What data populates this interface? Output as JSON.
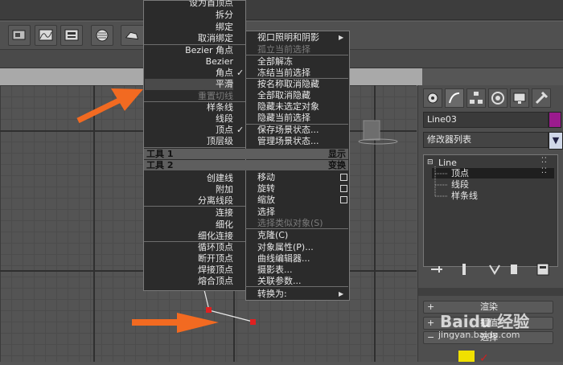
{
  "quad_menu": {
    "left_items": [
      {
        "label": "设为首顶点"
      },
      {
        "label": "拆分"
      },
      {
        "label": "绑定"
      },
      {
        "label": "取消绑定"
      },
      {
        "label": "Bezier 角点"
      },
      {
        "label": "Bezier"
      },
      {
        "label": "角点",
        "checked": true
      },
      {
        "label": "平滑"
      },
      {
        "label": "重置切线",
        "disabled": true
      },
      {
        "label": "样条线"
      },
      {
        "label": "线段"
      },
      {
        "label": "顶点",
        "checked": true
      },
      {
        "label": "顶层级"
      }
    ],
    "header_tools1": "工具 1",
    "header_display": "显示",
    "header_tools2": "工具 2",
    "header_transform": "变换",
    "lower_left_items": [
      {
        "label": "创建线"
      },
      {
        "label": "附加"
      },
      {
        "label": "分离线段"
      },
      {
        "label": "连接"
      },
      {
        "label": "细化"
      },
      {
        "label": "细化连接"
      },
      {
        "label": "循环顶点"
      },
      {
        "label": "断开顶点"
      },
      {
        "label": "焊接顶点"
      },
      {
        "label": "熔合顶点"
      }
    ],
    "right_items": [
      {
        "label": "视口照明和阴影"
      },
      {
        "label": "孤立当前选择",
        "disabled": true
      },
      {
        "label": "全部解冻"
      },
      {
        "label": "冻结当前选择"
      },
      {
        "label": "按名称取消隐藏"
      },
      {
        "label": "全部取消隐藏"
      },
      {
        "label": "隐藏未选定对象"
      },
      {
        "label": "隐藏当前选择"
      },
      {
        "label": "保存场景状态..."
      },
      {
        "label": "管理场景状态..."
      }
    ],
    "lower_right_items": [
      {
        "label": "移动"
      },
      {
        "label": "旋转"
      },
      {
        "label": "缩放"
      },
      {
        "label": "选择"
      },
      {
        "label": "选择类似对象(S)",
        "disabled": true
      },
      {
        "label": "克隆(C)"
      },
      {
        "label": "对象属性(P)..."
      },
      {
        "label": "曲线编辑器..."
      },
      {
        "label": "摄影表..."
      },
      {
        "label": "关联参数..."
      },
      {
        "label": "转换为:"
      }
    ]
  },
  "command_panel": {
    "object_name": "Line03",
    "object_color": "#9b1b8e",
    "modifier_list": "修改器列表",
    "stack": {
      "root": "Line",
      "children": [
        "顶点",
        "线段",
        "样条线"
      ],
      "selected": "顶点"
    },
    "rollouts": [
      "渲染",
      "插值",
      "选择"
    ],
    "tab_icons": [
      "create-icon",
      "modify-icon",
      "hierarchy-icon",
      "motion-icon",
      "display-icon",
      "utilities-icon"
    ],
    "stack_tool_icons": [
      "pin-stack-icon",
      "show-end-result-icon",
      "make-unique-icon",
      "remove-modifier-icon",
      "configure-sets-icon"
    ]
  },
  "toolbar": {
    "icons": [
      "render-setup-icon",
      "curve-editor-icon",
      "schematic-view-icon",
      "material-editor-icon",
      "render-frame-icon"
    ]
  },
  "watermark": {
    "text": "Baidu 经验",
    "url": "jingyan.baidu.com"
  },
  "annotations": {
    "arrow_color": "#f26a21"
  },
  "colors": {
    "menu_bg": "#2b2b2b",
    "highlight": "#4a4a4a",
    "vertex_red": "#e02020"
  }
}
